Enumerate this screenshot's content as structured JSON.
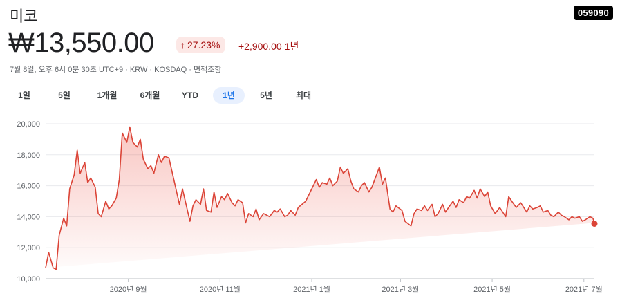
{
  "header": {
    "name": "미코",
    "ticker": "059090",
    "price": "₩13,550.00",
    "change_pct": "27.23%",
    "change_abs": "+2,900.00",
    "change_period": "1년",
    "meta": "7월 8일, 오후 6시 0분 30초 UTC+9 · KRW · KOSDAQ · 면책조항"
  },
  "colors": {
    "accent": "#db4437",
    "tab_active": "#1a73e8",
    "change": "#a50e0e"
  },
  "tabs": [
    {
      "label": "1일"
    },
    {
      "label": "5일"
    },
    {
      "label": "1개월"
    },
    {
      "label": "6개월"
    },
    {
      "label": "YTD"
    },
    {
      "label": "1년",
      "active": true
    },
    {
      "label": "5년"
    },
    {
      "label": "최대"
    }
  ],
  "chart_data": {
    "type": "area",
    "xlabel": "",
    "ylabel": "",
    "ylim": [
      10000,
      20000
    ],
    "yticks": [
      "20,000",
      "18,000",
      "16,000",
      "14,000",
      "12,000",
      "10,000"
    ],
    "ytick_values": [
      20000,
      18000,
      16000,
      14000,
      12000,
      10000
    ],
    "xticks": [
      {
        "label": "2020년 9월",
        "date": "2020-09-01"
      },
      {
        "label": "2020년 11월",
        "date": "2020-11-01"
      },
      {
        "label": "2021년 1월",
        "date": "2021-01-01"
      },
      {
        "label": "2021년 3월",
        "date": "2021-03-01"
      },
      {
        "label": "2021년 5월",
        "date": "2021-05-01"
      },
      {
        "label": "2021년 7월",
        "date": "2021-07-01"
      }
    ],
    "grid": true,
    "series": [
      {
        "dates": [
          "2020-07-08",
          "2020-07-10",
          "2020-07-13",
          "2020-07-15",
          "2020-07-17",
          "2020-07-20",
          "2020-07-22",
          "2020-07-24",
          "2020-07-27",
          "2020-07-29",
          "2020-07-31",
          "2020-08-03",
          "2020-08-05",
          "2020-08-07",
          "2020-08-10",
          "2020-08-12",
          "2020-08-14",
          "2020-08-17",
          "2020-08-19",
          "2020-08-21",
          "2020-08-24",
          "2020-08-26",
          "2020-08-28",
          "2020-08-31",
          "2020-09-02",
          "2020-09-04",
          "2020-09-07",
          "2020-09-09",
          "2020-09-11",
          "2020-09-14",
          "2020-09-16",
          "2020-09-18",
          "2020-09-21",
          "2020-09-23",
          "2020-09-25",
          "2020-09-28",
          "2020-10-05",
          "2020-10-07",
          "2020-10-12",
          "2020-10-14",
          "2020-10-16",
          "2020-10-19",
          "2020-10-21",
          "2020-10-23",
          "2020-10-26",
          "2020-10-28",
          "2020-10-30",
          "2020-11-02",
          "2020-11-04",
          "2020-11-06",
          "2020-11-09",
          "2020-11-11",
          "2020-11-13",
          "2020-11-16",
          "2020-11-18",
          "2020-11-20",
          "2020-11-23",
          "2020-11-25",
          "2020-11-27",
          "2020-11-30",
          "2020-12-02",
          "2020-12-04",
          "2020-12-07",
          "2020-12-09",
          "2020-12-11",
          "2020-12-14",
          "2020-12-16",
          "2020-12-18",
          "2020-12-21",
          "2020-12-23",
          "2020-12-28",
          "2020-12-30",
          "2021-01-04",
          "2021-01-06",
          "2021-01-08",
          "2021-01-11",
          "2021-01-13",
          "2021-01-15",
          "2021-01-18",
          "2021-01-20",
          "2021-01-22",
          "2021-01-25",
          "2021-01-27",
          "2021-01-29",
          "2021-02-01",
          "2021-02-03",
          "2021-02-05",
          "2021-02-08",
          "2021-02-10",
          "2021-02-15",
          "2021-02-17",
          "2021-02-19",
          "2021-02-22",
          "2021-02-24",
          "2021-02-26",
          "2021-03-02",
          "2021-03-04",
          "2021-03-08",
          "2021-03-10",
          "2021-03-12",
          "2021-03-15",
          "2021-03-17",
          "2021-03-19",
          "2021-03-22",
          "2021-03-24",
          "2021-03-26",
          "2021-03-29",
          "2021-03-31",
          "2021-04-02",
          "2021-04-05",
          "2021-04-07",
          "2021-04-09",
          "2021-04-12",
          "2021-04-14",
          "2021-04-16",
          "2021-04-19",
          "2021-04-21",
          "2021-04-23",
          "2021-04-26",
          "2021-04-28",
          "2021-04-30",
          "2021-05-03",
          "2021-05-06",
          "2021-05-10",
          "2021-05-12",
          "2021-05-14",
          "2021-05-17",
          "2021-05-20",
          "2021-05-24",
          "2021-05-26",
          "2021-05-28",
          "2021-05-31",
          "2021-06-02",
          "2021-06-04",
          "2021-06-07",
          "2021-06-09",
          "2021-06-11",
          "2021-06-14",
          "2021-06-16",
          "2021-06-18",
          "2021-06-21",
          "2021-06-23",
          "2021-06-25",
          "2021-06-28",
          "2021-06-30",
          "2021-07-02",
          "2021-07-05",
          "2021-07-07",
          "2021-07-08"
        ],
        "values": [
          10700,
          11700,
          10700,
          10600,
          12800,
          13900,
          13400,
          15800,
          16700,
          18300,
          16800,
          17500,
          16200,
          16500,
          15900,
          14200,
          14000,
          15000,
          14500,
          14700,
          15200,
          16400,
          19400,
          18800,
          19800,
          18800,
          18500,
          19000,
          17700,
          17100,
          17300,
          16800,
          18000,
          17500,
          17900,
          17800,
          14800,
          15800,
          13700,
          14700,
          15100,
          14800,
          15800,
          14400,
          14300,
          15600,
          14600,
          15300,
          15100,
          15500,
          14900,
          14700,
          15100,
          14900,
          13600,
          14200,
          14000,
          14500,
          13800,
          14200,
          14100,
          14000,
          14400,
          14300,
          14500,
          14000,
          14100,
          14400,
          14100,
          14600,
          15000,
          15400,
          16400,
          15900,
          16200,
          16100,
          16500,
          16000,
          16300,
          17200,
          16800,
          17100,
          16300,
          15800,
          15600,
          16000,
          16200,
          15600,
          15900,
          17200,
          16100,
          16500,
          14500,
          14300,
          14700,
          14400,
          13700,
          13400,
          14200,
          14500,
          14400,
          14700,
          14400,
          14800,
          14000,
          14200,
          14800,
          14300,
          14600,
          15000,
          14600,
          15100,
          14900,
          15300,
          15200,
          15700,
          15200,
          15800,
          15300,
          15600,
          14700,
          14200,
          14600,
          14000,
          15300,
          15000,
          14600,
          14900,
          14300,
          14700,
          14500,
          14600,
          14700,
          14300,
          14400,
          14100,
          14000,
          14300,
          14100,
          14000,
          13800,
          14000,
          13900,
          14000,
          13700,
          13800,
          14000,
          13900,
          13600,
          13550
        ]
      }
    ]
  }
}
